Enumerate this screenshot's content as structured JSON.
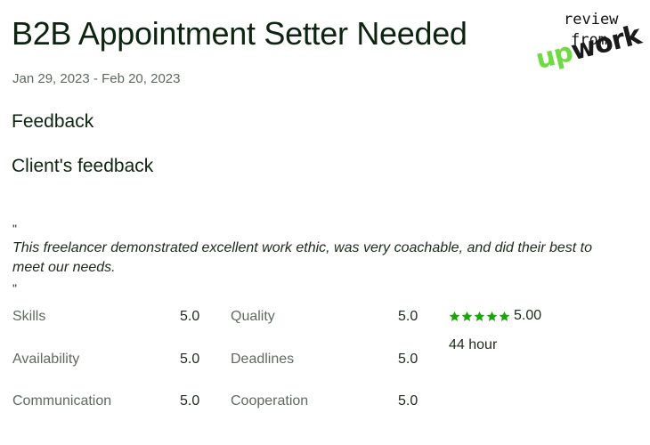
{
  "header": {
    "title": "B2B Appointment Setter Needed",
    "date_range": "Jan 29, 2023 - Feb 20, 2023"
  },
  "sections": {
    "feedback_heading": "Feedback",
    "client_feedback_heading": "Client's feedback"
  },
  "feedback": {
    "open_quote": "\"",
    "text": "This freelancer demonstrated excellent work ethic, was very coachable, and did their best to meet our needs.",
    "close_quote": "\""
  },
  "ratings": [
    {
      "label": "Skills",
      "value": "5.0"
    },
    {
      "label": "Quality",
      "value": "5.0"
    },
    {
      "label": "Availability",
      "value": "5.0"
    },
    {
      "label": "Deadlines",
      "value": "5.0"
    },
    {
      "label": "Communication",
      "value": "5.0"
    },
    {
      "label": "Cooperation",
      "value": "5.0"
    }
  ],
  "overall": {
    "stars": 5,
    "score": "5.00",
    "hours": "44 hour",
    "star_color": "#14a800"
  },
  "brand": {
    "line1": "review",
    "line2": "from",
    "logo_up": "up",
    "logo_work": "work",
    "logo_green": "#6fda44"
  }
}
